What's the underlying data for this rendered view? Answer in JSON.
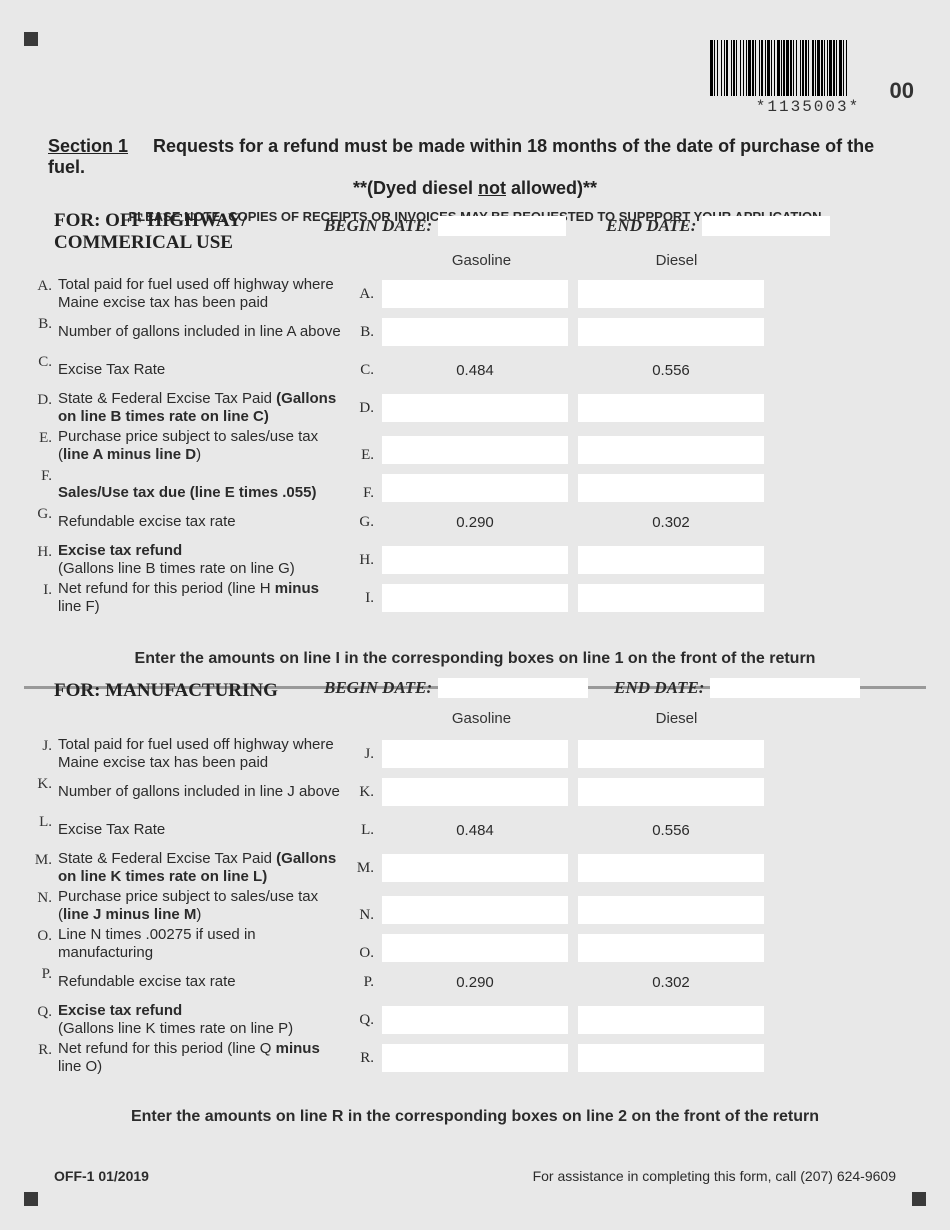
{
  "barcode_text": "*1135003*",
  "page_number": "00",
  "header": {
    "section_label": "Section 1",
    "main_line": "Requests for a refund must be made within 18 months of the date of purchase of the fuel.",
    "sub_line_pre": "**(Dyed diesel ",
    "sub_line_not": "not",
    "sub_line_post": " allowed)**",
    "note": "PLEASE NOTE: COPIES OF RECEIPTS OR INVOICES MAY BE REQUESTED TO SUPPPORT YOUR APPLICATION"
  },
  "col_gasoline": "Gasoline",
  "col_diesel": "Diesel",
  "begin_date_label": "BEGIN DATE:",
  "end_date_label": "END DATE:",
  "sec1": {
    "for_title1": "FOR: OFF HIGHWAY/",
    "for_title2": "COMMERICAL USE",
    "rows": {
      "A": {
        "m": "A.",
        "d": "Total paid for fuel used off highway where Maine excise tax has been paid",
        "m2": "A."
      },
      "B": {
        "m": "B.",
        "d": "Number of gallons included in line A above",
        "m2": "B."
      },
      "C": {
        "m": "C.",
        "d": "Excise Tax Rate",
        "m2": "C.",
        "gas": "0.484",
        "diesel": "0.556"
      },
      "D": {
        "m": "D.",
        "d_pre": "State & Federal Excise Tax Paid ",
        "d_bold": "(Gallons on line B times rate on line C)",
        "m2": "D."
      },
      "E": {
        "m": "E.",
        "d_pre": "Purchase price subject to sales/use tax (",
        "d_bold": "line A minus line D",
        "d_post": ")",
        "m2": "E."
      },
      "F": {
        "m": "F.",
        "d_bold": "Sales/Use tax due (line E times .055)",
        "m2": "F."
      },
      "G": {
        "m": "G.",
        "d": "Refundable excise tax rate",
        "m2": "G.",
        "gas": "0.290",
        "diesel": "0.302"
      },
      "H": {
        "m": "H.",
        "d_bold": "Excise tax refund",
        "d_post_nl": "(Gallons line B times rate on line G)",
        "m2": "H."
      },
      "I": {
        "m": "I.",
        "d_pre": "Net refund for this period (line H ",
        "d_bold": "minus",
        "d_post": " line F)",
        "m2": "I."
      }
    },
    "instruction": "Enter the amounts on line I in the corresponding boxes on line 1 on the front of the return"
  },
  "sec2": {
    "for_title": "FOR: MANUFACTURING",
    "rows": {
      "J": {
        "m": "J.",
        "d": "Total paid for fuel used off highway where Maine excise tax has been paid",
        "m2": "J."
      },
      "K": {
        "m": "K.",
        "d": "Number of gallons included in line J above",
        "m2": "K."
      },
      "L": {
        "m": "L.",
        "d": "Excise Tax Rate",
        "m2": "L.",
        "gas": "0.484",
        "diesel": "0.556"
      },
      "M": {
        "m": "M.",
        "d_pre": "State & Federal Excise Tax Paid ",
        "d_bold": "(Gallons on line K times rate on line L)",
        "m2": "M."
      },
      "N": {
        "m": "N.",
        "d_pre": "Purchase price subject to sales/use tax (",
        "d_bold": "line J minus line M",
        "d_post": ")",
        "m2": "N."
      },
      "O": {
        "m": "O.",
        "d": "Line N times .00275 if used in manufacturing",
        "m2": "O."
      },
      "P": {
        "m": "P.",
        "d": "Refundable excise tax rate",
        "m2": "P.",
        "gas": "0.290",
        "diesel": "0.302"
      },
      "Q": {
        "m": "Q.",
        "d_bold": "Excise tax refund",
        "d_post_nl": "(Gallons line K times rate on line P)",
        "m2": "Q."
      },
      "R": {
        "m": "R.",
        "d_pre": "Net refund for this period (line Q ",
        "d_bold": "minus",
        "d_post": " line O)",
        "m2": "R."
      }
    },
    "instruction": "Enter the amounts on line R in the corresponding boxes on line 2 on the front of the return"
  },
  "footer": {
    "form_id": "OFF-1 01/2019",
    "assist": "For assistance in completing this form, call (207) 624-9609"
  }
}
